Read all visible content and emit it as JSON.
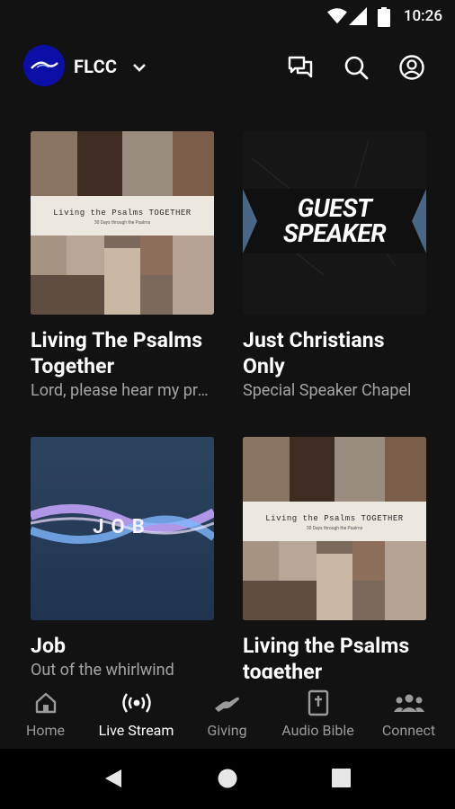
{
  "status_bar": {
    "time": "10:26"
  },
  "header": {
    "church_name": "FLCC"
  },
  "cards": [
    {
      "title": "Living The Psalms Together",
      "subtitle": "Lord, please hear my prayer",
      "art_line1": "Living the Psalms TOGETHER",
      "art_line2": "30 Days through the Psalms"
    },
    {
      "title": "Just Christians Only",
      "subtitle": "Special Speaker Chapel",
      "art_line1": "GUEST",
      "art_line2": "SPEAKER"
    },
    {
      "title": "Job",
      "subtitle": "Out of the whirlwind",
      "art_text": "JOB"
    },
    {
      "title": "Living the Psalms together",
      "subtitle": "",
      "art_line1": "Living the Psalms TOGETHER",
      "art_line2": "30 Days through the Psalms"
    }
  ],
  "bottom_nav": [
    {
      "label": "Home",
      "icon": "home-icon"
    },
    {
      "label": "Live Stream",
      "icon": "broadcast-icon",
      "active": true
    },
    {
      "label": "Giving",
      "icon": "giving-hand-icon"
    },
    {
      "label": "Audio Bible",
      "icon": "bible-icon"
    },
    {
      "label": "Connect",
      "icon": "people-icon"
    }
  ]
}
